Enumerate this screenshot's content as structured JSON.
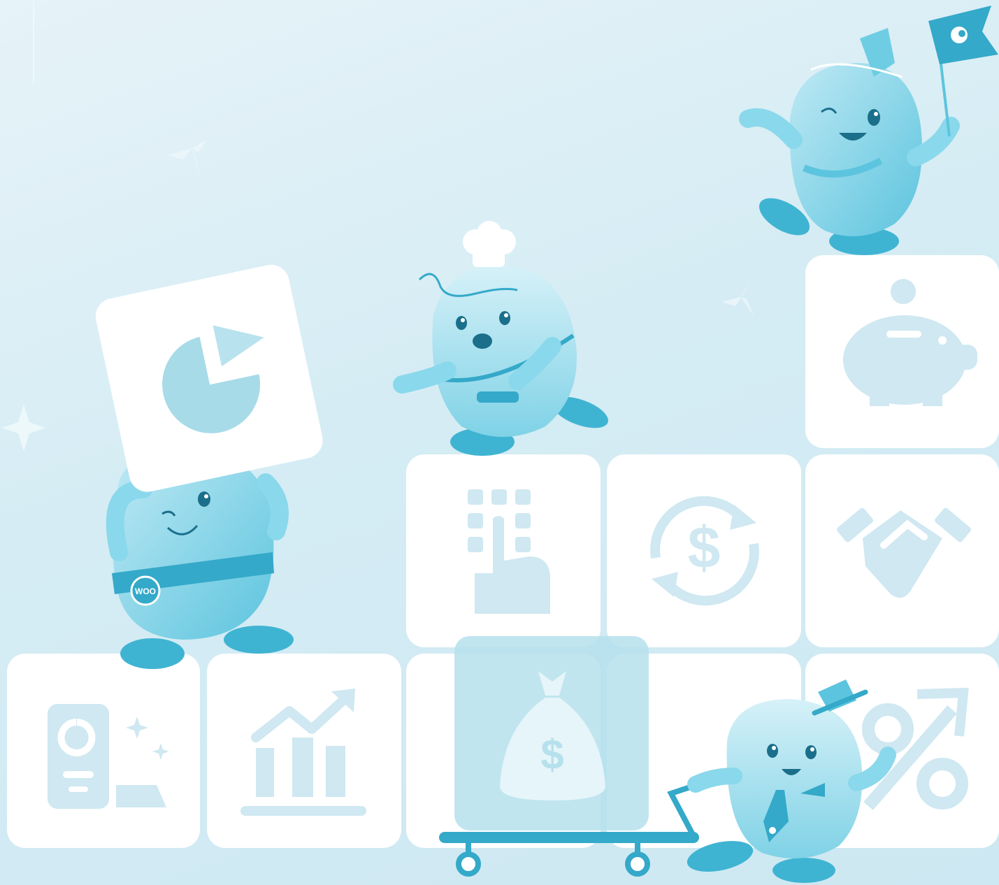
{
  "scene": {
    "background": "#d5ecf4",
    "tile_color": "#ffffff",
    "icon_color": "#cfe8f1",
    "mascot_color": "#7dd0e4",
    "mascot_dark": "#3fb4d2",
    "belt_color": "#34a9c9"
  },
  "tiles": [
    {
      "icon": "wallet-phone-gold-icon"
    },
    {
      "icon": "bar-chart-trend-icon"
    },
    {
      "icon": "blank-tile"
    },
    {
      "icon": "blank-tile"
    },
    {
      "icon": "percent-arrow-icon"
    },
    {
      "icon": "keypad-hand-icon"
    },
    {
      "icon": "dollar-cycle-icon"
    },
    {
      "icon": "handshake-icon"
    },
    {
      "icon": "piggy-bank-icon"
    }
  ],
  "props": [
    {
      "icon": "pie-chart-card-icon"
    },
    {
      "icon": "money-bag-box-icon"
    },
    {
      "icon": "hand-cart-icon"
    },
    {
      "icon": "flag-icon"
    }
  ],
  "mascots": [
    {
      "name": "mascot-worker",
      "badge": "WOO"
    },
    {
      "name": "mascot-chef"
    },
    {
      "name": "mascot-flag-bearer"
    },
    {
      "name": "mascot-businessman"
    }
  ]
}
